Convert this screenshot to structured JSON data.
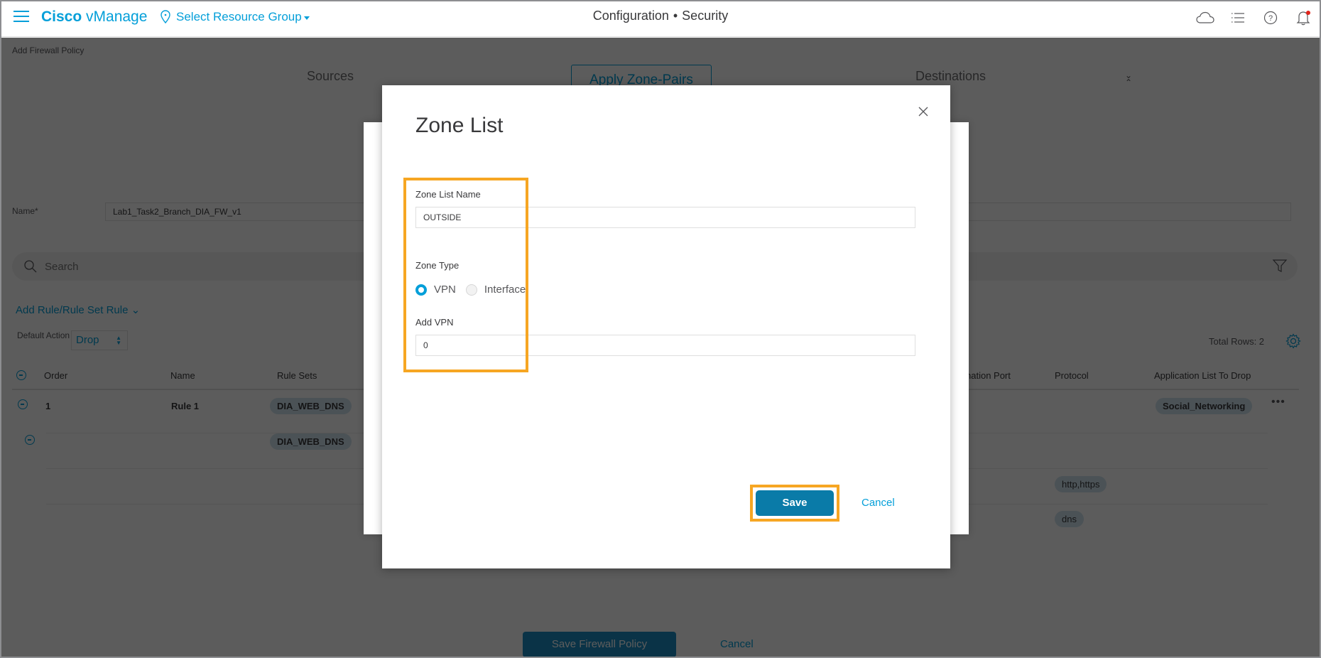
{
  "header": {
    "brand_bold": "Cisco",
    "brand_rest": " vManage",
    "resource_group": "Select Resource Group",
    "breadcrumb_section": "Configuration",
    "breadcrumb_separator": "•",
    "breadcrumb_page": "Security",
    "icons": [
      "cloud-icon",
      "task-list-icon",
      "help-icon",
      "notification-bell-icon"
    ],
    "accent_color": "#049fd9",
    "alert_color": "#e2231a"
  },
  "page": {
    "title": "Add Firewall Policy",
    "steps": [
      "Sources",
      "Apply Zone-Pairs",
      "Destinations"
    ],
    "active_step": "Apply Zone-Pairs",
    "name_label": "Name*",
    "name_value": "Lab1_Task2_Branch_DIA_FW_v1",
    "search_placeholder": "Search",
    "add_rule_label": "Add Rule/Rule Set Rule",
    "default_action_label": "Default Action",
    "default_action_value": "Drop",
    "total_rows": "Total Rows: 2",
    "table": {
      "headers": [
        "Order",
        "Name",
        "Rule Sets",
        "stination Port",
        "Protocol",
        "Application List To Drop"
      ],
      "rows": [
        {
          "order": "1",
          "name": "Rule 1",
          "rule_set": "DIA_WEB_DNS",
          "protocol": "",
          "app_list": "Social_Networking"
        },
        {
          "order": "",
          "name": "",
          "rule_set": "DIA_WEB_DNS",
          "protocol": "",
          "app_list": ""
        },
        {
          "order": "",
          "name": "",
          "rule_set": "",
          "protocol": "http,https",
          "app_list": ""
        },
        {
          "order": "",
          "name": "",
          "rule_set": "",
          "protocol": "dns",
          "app_list": ""
        }
      ]
    },
    "save_button": "Save Firewall Policy",
    "cancel_button": "Cancel"
  },
  "modal": {
    "title": "Zone List",
    "zone_list_name_label": "Zone List Name",
    "zone_list_name_value": "OUTSIDE",
    "zone_type_label": "Zone Type",
    "zone_type_options": [
      "VPN",
      "Interface"
    ],
    "zone_type_selected": "VPN",
    "add_vpn_label": "Add VPN",
    "add_vpn_value": "0",
    "save_button": "Save",
    "cancel_button": "Cancel",
    "highlight_color": "#f6a623"
  }
}
